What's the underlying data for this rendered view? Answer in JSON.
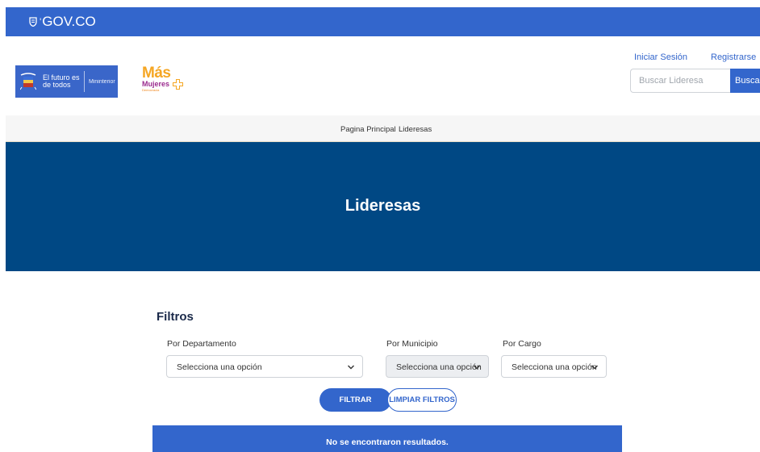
{
  "gov_bar": {
    "logo_text": "GOV.CO",
    "separator": "'"
  },
  "header": {
    "mininterior": {
      "slogan": "El futuro es de todos",
      "ministry": "Mininterior"
    },
    "mas_mujeres": {
      "mas": "Más",
      "mujeres": "Mujeres",
      "democracia": "Democracia"
    },
    "login_link": "Iniciar Sesión",
    "register_link": "Registrarse",
    "search": {
      "placeholder": "Buscar Lideresa",
      "button_label": "Buscar"
    }
  },
  "nav": {
    "items": [
      {
        "label": "Pagina Principal"
      },
      {
        "label": "Lideresas"
      }
    ]
  },
  "hero": {
    "title": "Lideresas"
  },
  "filters": {
    "title": "Filtros",
    "departamento": {
      "label": "Por Departamento",
      "value": "Selecciona una opción"
    },
    "municipio": {
      "label": "Por Municipio",
      "value": "Selecciona una opción"
    },
    "cargo": {
      "label": "Por Cargo",
      "value": "Selecciona una opción"
    },
    "filter_button": "FILTRAR",
    "clear_button": "LIMPIAR FILTROS"
  },
  "results": {
    "message": "No se encontraron resultados."
  },
  "colors": {
    "gov_blue": "#3366cc",
    "hero_blue": "#004884",
    "mas_orange": "#f5a623",
    "mujeres_purple": "#9b2c8f"
  },
  "icons": [
    "colombia-shield-icon",
    "coat-of-arms-icon",
    "plus-icon",
    "chevron-down-icon"
  ]
}
